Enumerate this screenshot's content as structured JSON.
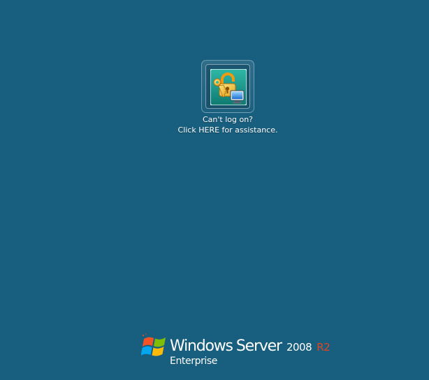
{
  "help_tile": {
    "icon": "key-lock-monitor-icon",
    "line1": "Can't log on?",
    "line2": "Click HERE for assistance."
  },
  "branding": {
    "logo_icon": "windows-flag-icon",
    "product_windows": "Windows",
    "product_server": "Server",
    "version": "2008",
    "release": "R2",
    "edition": "Enterprise",
    "release_color": "#e2461f"
  },
  "colors": {
    "background": "#185e7e",
    "text": "#ffffff"
  }
}
